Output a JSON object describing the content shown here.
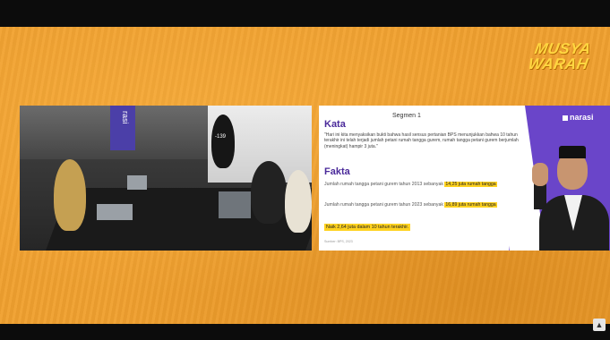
{
  "logo": {
    "line1": "MUSYA",
    "line2": "WARAH"
  },
  "slide": {
    "brand": "narasi",
    "segment": "Segmen 1",
    "kata_heading": "Kata",
    "kata_text": "\"Hari ini kita menyaksikan bukti bahwa hasil sensus pertanian BPS menunjukkan bahwa 10 tahun terakhir ini telah terjadi jumlah petani rumah tangga gurem, rumah tangga petani gurem berjumlah (meningkat) hampir 3 juta.\"",
    "fakta_heading": "Fakta",
    "fact1_prefix": "Jumlah rumah tangga petani gurem tahun 2013 sebanyak",
    "fact1_highlight": "14,25 juta rumah tangga",
    "fact2_prefix": "Jumlah rumah tangga petani gurem tahun 2023 sebanyak",
    "fact2_highlight": "16,89 juta rumah tangga",
    "fact3": "Naik 2,64 juta dalam 10 tahun terakhir.",
    "source": "Sumber: BPS, 2023"
  },
  "photo": {
    "banner_text": "rasi",
    "shirt_number": "-139"
  },
  "icons": {
    "corner": "channel-watermark-icon"
  }
}
